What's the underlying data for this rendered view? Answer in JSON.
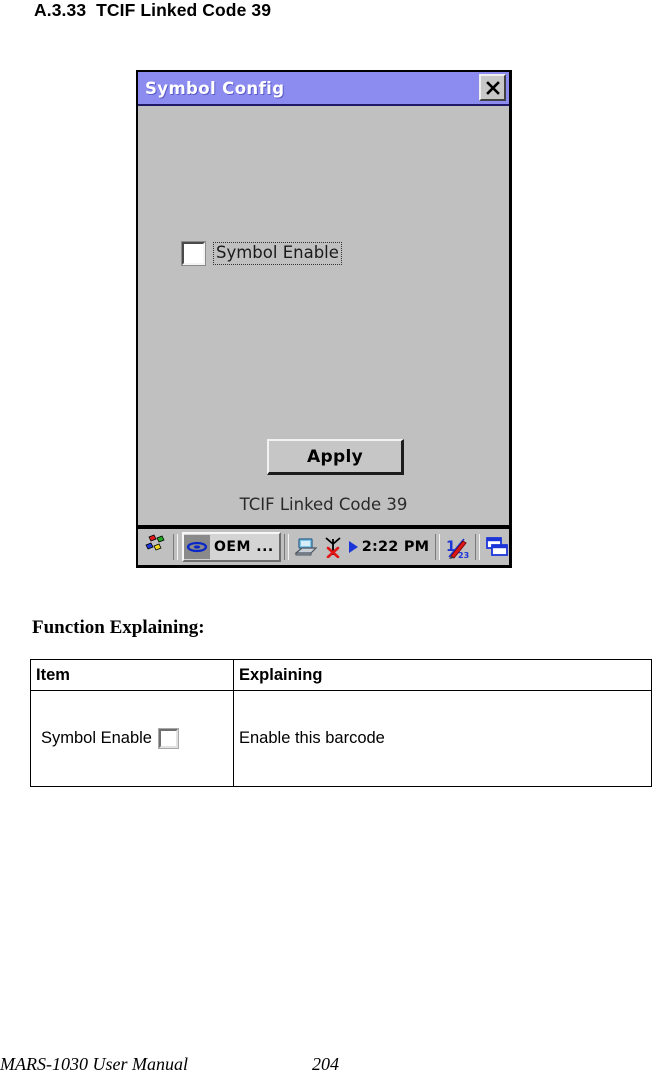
{
  "document": {
    "heading": "A.3.33  TCIF Linked Code 39",
    "function_heading": "Function Explaining:",
    "footer": {
      "manual_title": "MARS-1030 User Manual",
      "page_number": "204"
    }
  },
  "screenshot": {
    "window": {
      "title": "Symbol Config",
      "title_bar_color": "#8c8cf0",
      "body_color": "#c0c0c0",
      "close_icon": "close-icon",
      "close_label": "×"
    },
    "controls": {
      "checkbox": {
        "label": "Symbol Enable",
        "checked": false
      },
      "apply_button": "Apply",
      "symbology_label": "TCIF Linked Code 39"
    },
    "taskbar": {
      "start_icon": "windows-start-flag-icon",
      "task_button": {
        "icon": "oem-app-icon",
        "label": "OEM ..."
      },
      "tray": [
        {
          "icon": "desktop-connection-icon",
          "name": "desktop-connection-icon"
        },
        {
          "icon": "antenna-no-signal-icon",
          "name": "antenna-no-signal-icon"
        },
        {
          "icon": "play-triangle-icon",
          "name": "play-triangle-icon"
        }
      ],
      "clock": "2:22 PM",
      "right_icons": [
        {
          "icon": "input-panel-icon",
          "name": "input-panel-icon"
        },
        {
          "icon": "window-switch-icon",
          "name": "window-switch-icon"
        }
      ]
    }
  },
  "table": {
    "headers": [
      "Item",
      "Explaining"
    ],
    "rows": [
      {
        "item": "Symbol Enable",
        "item_has_checkbox": true,
        "explaining": "Enable this barcode"
      }
    ]
  }
}
